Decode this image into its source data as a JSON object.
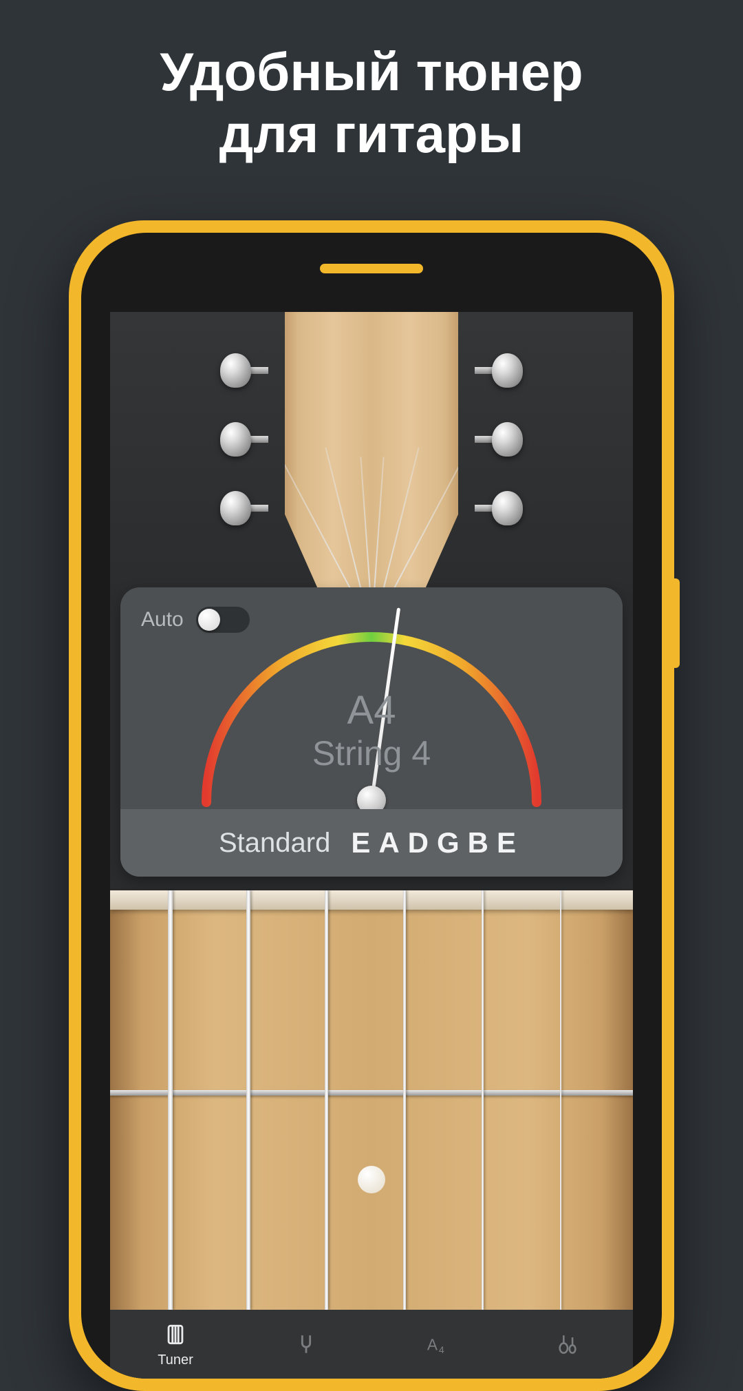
{
  "headline": {
    "line1": "Удобный тюнер",
    "line2": "для гитары"
  },
  "tuner": {
    "auto_label": "Auto",
    "auto_on": false,
    "note": "A4",
    "string_label": "String 4",
    "tuning_name": "Standard",
    "tuning_notes": "EADGBE",
    "needle_angle_deg": 8
  },
  "nav": {
    "items": [
      {
        "label": "Tuner",
        "icon": "tuner-icon",
        "active": true
      },
      {
        "label": "",
        "icon": "tuning-fork-icon",
        "active": false
      },
      {
        "label": "",
        "icon": "pitch-icon",
        "active": false
      },
      {
        "label": "",
        "icon": "instruments-icon",
        "active": false
      }
    ]
  },
  "colors": {
    "accent": "#f2b72b"
  }
}
